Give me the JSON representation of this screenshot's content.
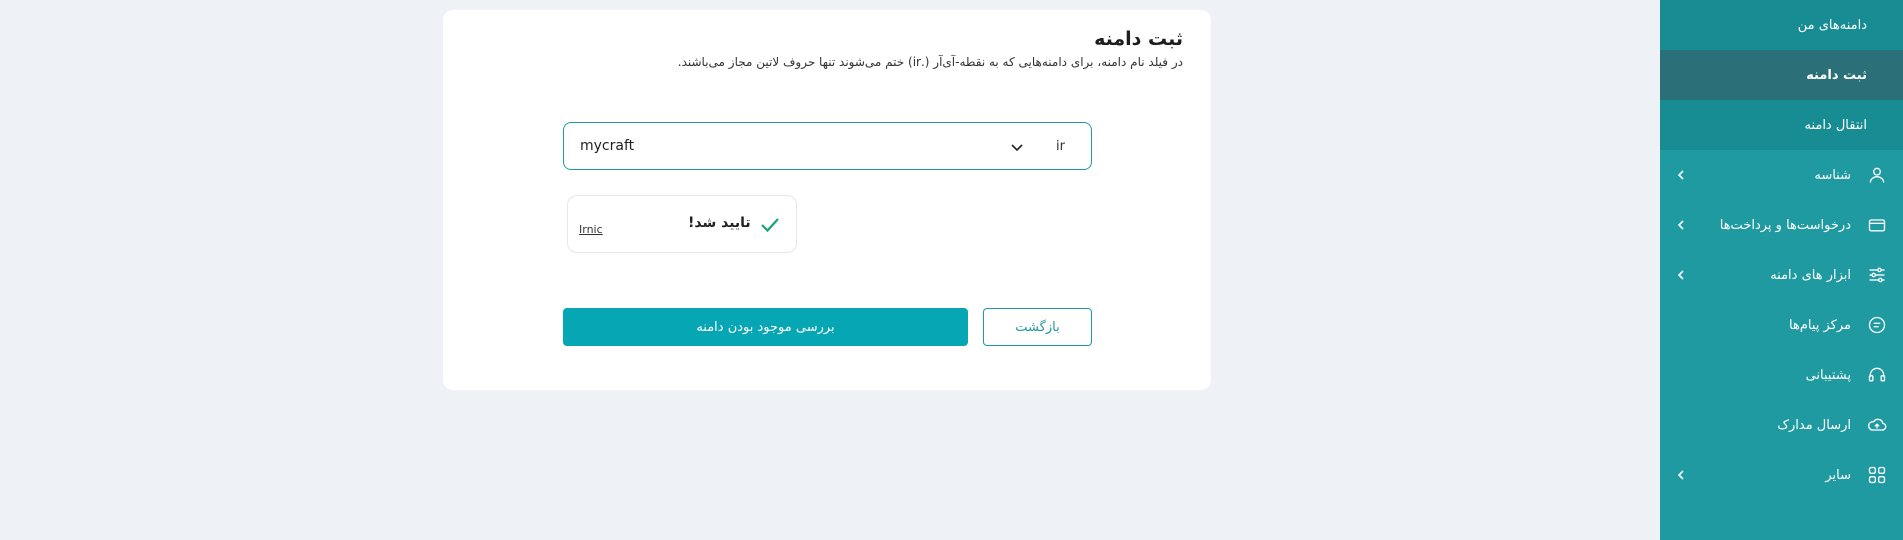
{
  "sidebar": {
    "sub_items": [
      {
        "label": "دامنه‌های من"
      },
      {
        "label": "ثبت دامنه"
      },
      {
        "label": "انتقال دامنه"
      }
    ],
    "items": [
      {
        "label": "شناسه",
        "icon": "user-icon"
      },
      {
        "label": "درخواست‌ها و پرداخت‌ها",
        "icon": "credit-card-icon"
      },
      {
        "label": "ابزار های دامنه",
        "icon": "sliders-icon"
      },
      {
        "label": "مرکز پیام‌ها",
        "icon": "message-icon"
      },
      {
        "label": "پشتیبانی",
        "icon": "headset-icon"
      },
      {
        "label": "ارسال مدارک",
        "icon": "cloud-upload-icon"
      },
      {
        "label": "سایر",
        "icon": "grid-icon"
      }
    ]
  },
  "card": {
    "title": "ثبت دامنه",
    "description": "در فیلد نام دامنه، برای دامنه‌هایی که به نقطه-آی‌آر (.ir) ختم می‌شوند تنها حروف لاتین مجاز می‌باشند.",
    "domain_value": "mycraft",
    "tld_value": "ir",
    "verify": {
      "status": "تایید شد!",
      "provider": "Irnic"
    },
    "buttons": {
      "check": "بررسی موجود بودن دامنه",
      "back": "بازگشت"
    }
  },
  "colors": {
    "sidebar": "#1f9aa0",
    "accent": "#06a6b4",
    "success": "#1aa37a"
  }
}
